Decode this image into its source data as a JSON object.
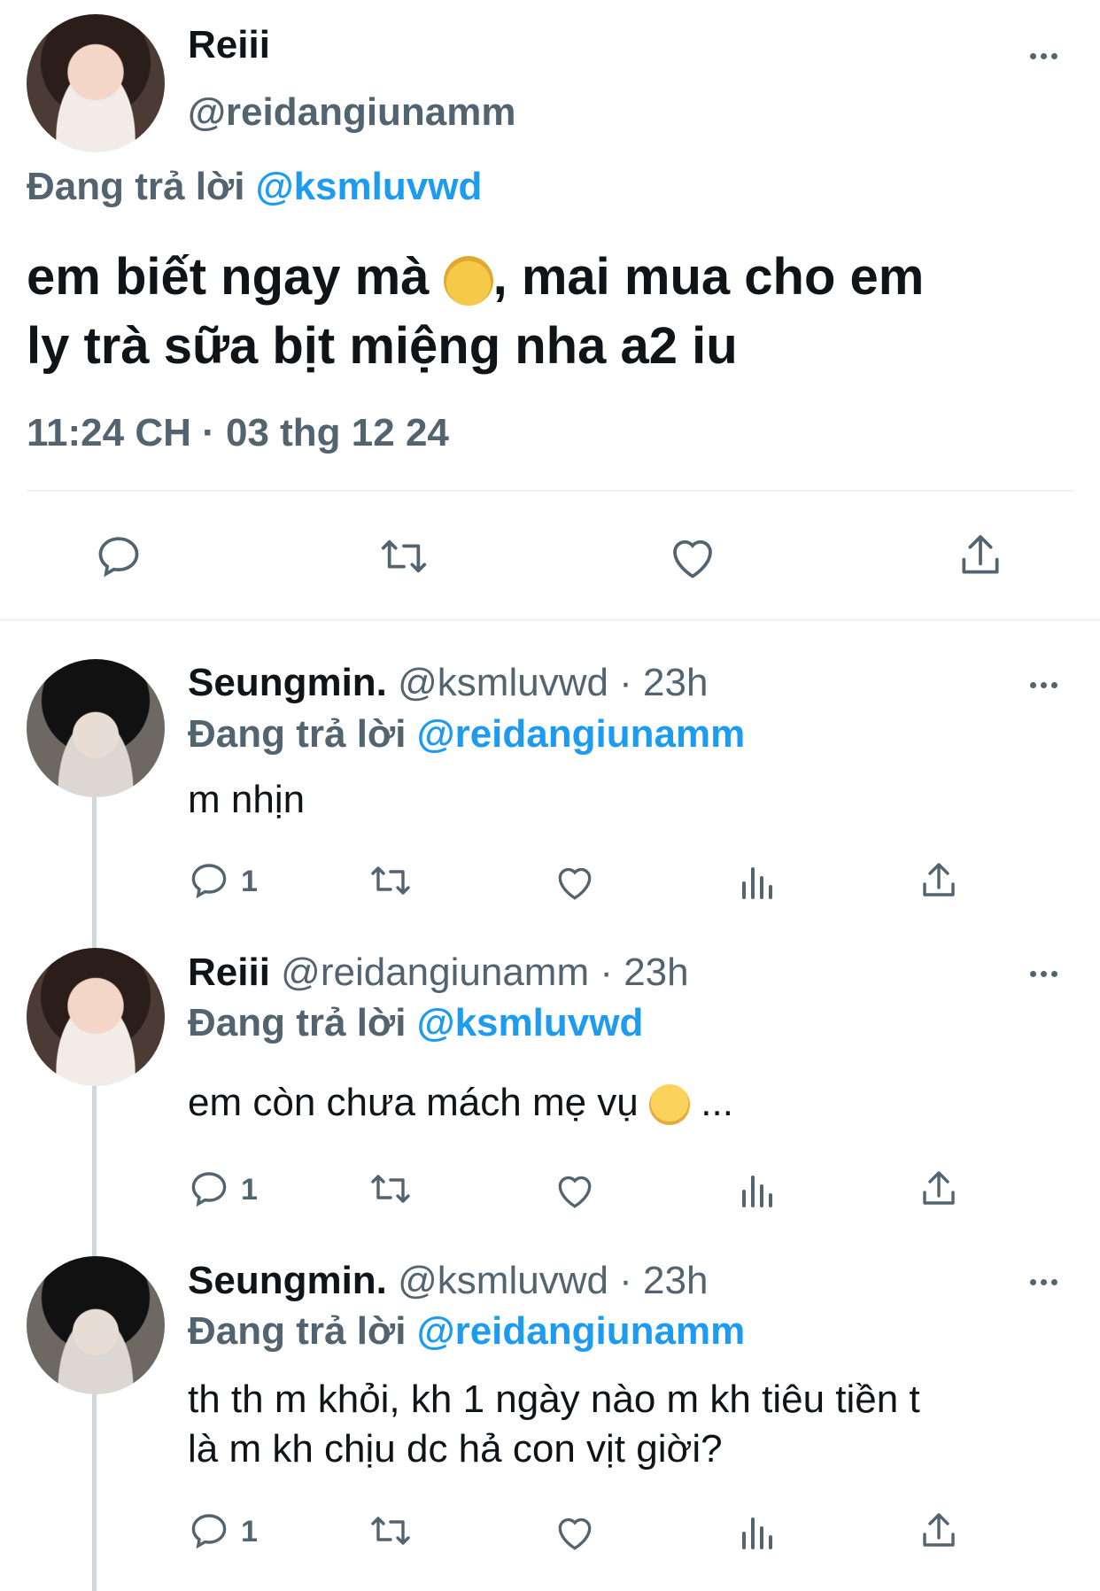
{
  "main_tweet": {
    "name": "Reiii",
    "handle": "@reidangiunamm",
    "replying_label": "Đang trả lời",
    "replying_to": "@ksmluvwd",
    "text_part1": "em biết ngay mà",
    "text_part2": ", mai mua cho em",
    "text_line2": "ly trà sữa bịt miệng nha a2 iu",
    "timestamp": "11:24 CH · 03 thg 12 24"
  },
  "replies": [
    {
      "name": "Seungmin.",
      "handle": "@ksmluvwd · 23h",
      "replying_label": "Đang trả lời",
      "replying_to": "@reidangiunamm",
      "text": "m nhịn",
      "reply_count": "1"
    },
    {
      "name": "Reiii",
      "handle": "@reidangiunamm · 23h",
      "replying_label": "Đang trả lời",
      "replying_to": "@ksmluvwd",
      "text": "em còn chưa mách mẹ vụ",
      "text_tail": "...",
      "reply_count": "1"
    },
    {
      "name": "Seungmin.",
      "handle": "@ksmluvwd · 23h",
      "replying_label": "Đang trả lời",
      "replying_to": "@reidangiunamm",
      "text_line1": "th th m khỏi, kh 1 ngày nào m kh tiêu tiền t",
      "text_line2": "là m kh chịu dc hả con vịt giời?",
      "reply_count": "1"
    }
  ],
  "colors": {
    "accent": "#1d9bf0",
    "secondary": "#536471",
    "divider": "#eff3f4"
  }
}
